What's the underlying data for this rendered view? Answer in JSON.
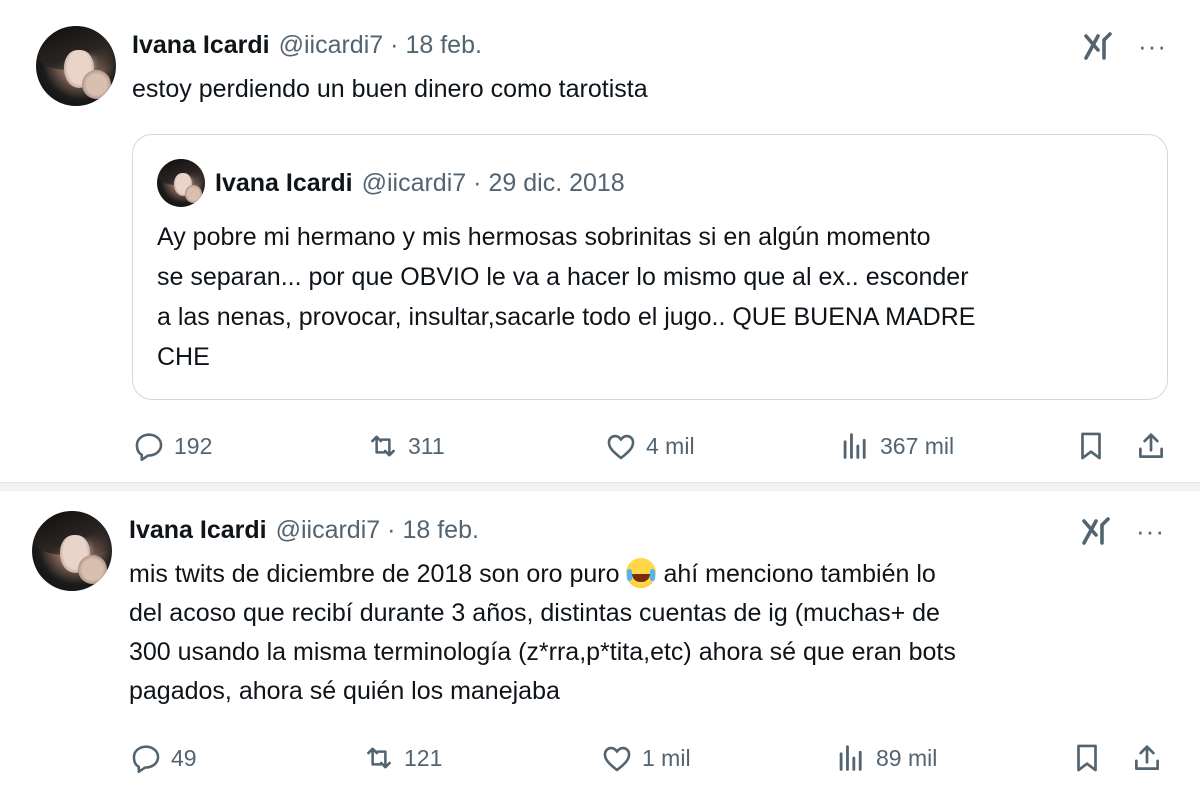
{
  "tweets": [
    {
      "author": "Ivana Icardi",
      "handle": "@iicardi7",
      "separator": "·",
      "date": "18 feb.",
      "text": "estoy perdiendo un buen dinero como tarotista",
      "quote": {
        "author": "Ivana Icardi",
        "handle": "@iicardi7",
        "separator": "·",
        "date": "29 dic. 2018",
        "lines": [
          "Ay pobre mi hermano y mis hermosas sobrinitas si en algún momento",
          "se separan... por que OBVIO le va a hacer lo mismo que al ex.. esconder",
          "a las nenas, provocar, insultar,sacarle todo el jugo.. QUE BUENA MADRE",
          "CHE"
        ]
      },
      "stats": {
        "replies": "192",
        "reposts": "311",
        "likes": "4 mil",
        "views": "367 mil"
      },
      "more": "···"
    },
    {
      "author": "Ivana Icardi",
      "handle": "@iicardi7",
      "separator": "·",
      "date": "18 feb.",
      "line1_before_emoji": "mis twits de diciembre de 2018 son oro puro",
      "line1_after_emoji": "ahí menciono también lo",
      "lines_rest": [
        "del acoso que recibí durante 3 años, distintas cuentas de ig (muchas+ de",
        "300 usando la misma terminología (z*rra,p*tita,etc)  ahora sé que eran bots",
        "pagados, ahora sé quién los manejaba"
      ],
      "emoji": "face-with-tears-of-joy",
      "stats": {
        "replies": "49",
        "reposts": "121",
        "likes": "1 mil",
        "views": "89 mil"
      },
      "more": "···"
    }
  ],
  "colors": {
    "text": "#0f1419",
    "secondary": "#536471",
    "border": "#cfd9de"
  },
  "icons": [
    "grok-icon",
    "more-icon",
    "reply-icon",
    "repost-icon",
    "like-icon",
    "views-icon",
    "bookmark-icon",
    "share-icon"
  ]
}
